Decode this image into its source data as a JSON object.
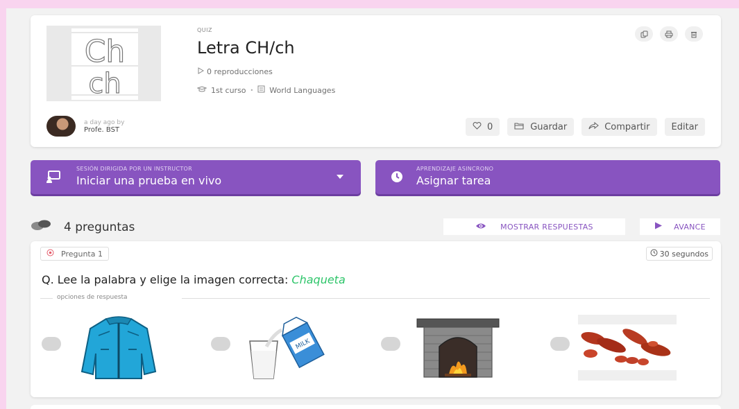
{
  "quiz": {
    "type_label": "QUIZ",
    "title": "Letra CH/ch",
    "plays": "0 reproducciones",
    "grade": "1st curso",
    "subject": "World Languages",
    "thumbnail": {
      "upper": "Ch",
      "lower": "ch"
    },
    "author_time": "a day ago by",
    "author_name": "Profe. BST",
    "top_actions": [
      "copy-icon",
      "print-icon",
      "delete-icon"
    ],
    "like_count": "0",
    "save_label": "Guardar",
    "share_label": "Compartir",
    "edit_label": "Editar"
  },
  "live": {
    "small": "SESIÓN DIRIGIDA POR UN INSTRUCTOR",
    "big": "Iniciar una prueba en vivo"
  },
  "async": {
    "small": "APRENDIZAJE ASINCRONO",
    "big": "Asignar tarea"
  },
  "questions": {
    "count_label": "4 preguntas",
    "show_answers": "MOSTRAR RESPUESTAS",
    "preview": "AVANCE"
  },
  "question1": {
    "badge": "Pregunta 1",
    "time": "30 segundos",
    "text_prefix": "Q. Lee la palabra y elige la imagen correcta: ",
    "highlight": "Chaqueta",
    "options_label": "opciones de respuesta",
    "options": [
      {
        "icon": "jacket-image"
      },
      {
        "icon": "milk-image",
        "carton_text": "MILK"
      },
      {
        "icon": "fireplace-image"
      },
      {
        "icon": "sausage-image"
      }
    ]
  },
  "colors": {
    "accent": "#8854c0",
    "highlight": "#2ec56a",
    "pink": "#f9d4ef"
  }
}
